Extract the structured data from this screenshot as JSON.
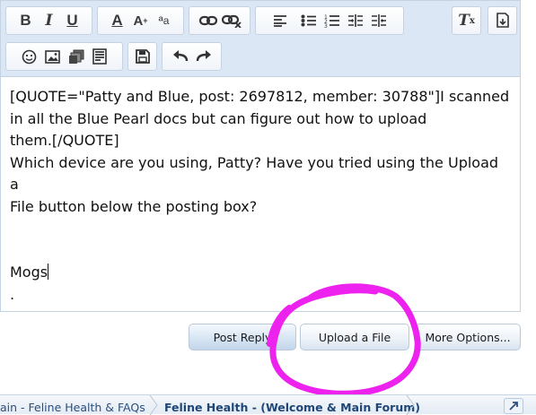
{
  "toolbar": {
    "row1": [
      {
        "name": "bold-button",
        "icon": "bold-icon",
        "glyph": "B"
      },
      {
        "name": "italic-button",
        "icon": "italic-icon",
        "glyph": "I"
      },
      {
        "name": "underline-button",
        "icon": "underline-icon",
        "glyph": "U"
      },
      {
        "name": "text-color-button",
        "icon": "text-color-icon",
        "glyph": "A"
      },
      {
        "name": "font-size-button",
        "icon": "font-size-icon",
        "glyph": "A"
      },
      {
        "name": "font-family-button",
        "icon": "font-family-icon",
        "glyph": "a"
      },
      {
        "name": "link-button",
        "icon": "link-icon"
      },
      {
        "name": "unlink-button",
        "icon": "unlink-icon"
      },
      {
        "name": "align-button",
        "icon": "align-left-icon"
      },
      {
        "name": "bullet-list-button",
        "icon": "bullet-list-icon"
      },
      {
        "name": "numbered-list-button",
        "icon": "numbered-list-icon"
      },
      {
        "name": "outdent-button",
        "icon": "outdent-icon"
      },
      {
        "name": "indent-button",
        "icon": "indent-icon"
      },
      {
        "name": "remove-format-button",
        "icon": "remove-format-icon",
        "glyph": "T"
      },
      {
        "name": "toggle-bbcode-button",
        "icon": "bbcode-toggle-icon"
      }
    ],
    "row2": [
      {
        "name": "smilies-button",
        "icon": "smiley-icon"
      },
      {
        "name": "image-button",
        "icon": "image-icon"
      },
      {
        "name": "media-button",
        "icon": "media-icon"
      },
      {
        "name": "insert-button",
        "icon": "insert-icon"
      },
      {
        "name": "save-draft-button",
        "icon": "floppy-disk-icon"
      },
      {
        "name": "undo-button",
        "icon": "undo-icon"
      },
      {
        "name": "redo-button",
        "icon": "redo-icon"
      }
    ]
  },
  "editor": {
    "lines": [
      "[QUOTE=\"Patty and Blue, post: 2697812, member: 30788\"]I scanned",
      "in all the Blue Pearl docs but can figure out how to upload",
      "them.[/QUOTE]",
      "Which device are you using, Patty? Have you tried using the Upload a",
      "File button below the posting box?",
      "",
      "",
      "Mogs",
      "."
    ]
  },
  "buttons": {
    "post_reply": "Post Reply",
    "upload_file": "Upload a File",
    "more_options": "More Options..."
  },
  "breadcrumb": {
    "parent": "ain - Feline Health & FAQs",
    "current": "Feline Health - (Welcome & Main Forum)"
  },
  "colors": {
    "toolbar_bg": "#dbe7f4",
    "scribble": "#ee22ee",
    "link": "#2b4e7d"
  }
}
